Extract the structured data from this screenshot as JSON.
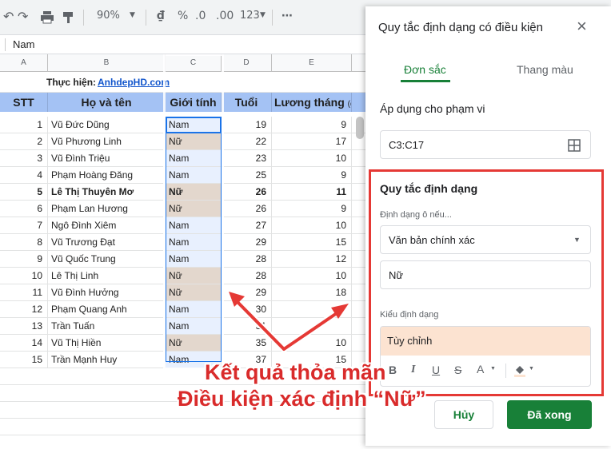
{
  "toolbar": {
    "zoom": "90%",
    "currency": "₫",
    "percent": "%",
    "decrease_decimal": ".0",
    "increase_decimal": ".00",
    "format_more": "123",
    "more": "⋯"
  },
  "formula_bar": {
    "value": "Nam"
  },
  "columns": [
    "A",
    "B",
    "C",
    "D",
    "E"
  ],
  "sheet": {
    "creator_label": "Thực hiện:",
    "creator_link": "AnhdepHD.com",
    "headers": {
      "stt": "STT",
      "name": "Họ và tên",
      "gender": "Giới tính",
      "age": "Tuổi",
      "salary": "Lương tháng"
    },
    "salary_unit": "(đ",
    "rows": [
      {
        "stt": "1",
        "name": "Vũ Đức Dũng",
        "gender": "Nam",
        "age": "19",
        "salary": "9"
      },
      {
        "stt": "2",
        "name": "Vũ Phương Linh",
        "gender": "Nữ",
        "age": "22",
        "salary": "17"
      },
      {
        "stt": "3",
        "name": "Vũ Đình Triệu",
        "gender": "Nam",
        "age": "23",
        "salary": "10"
      },
      {
        "stt": "4",
        "name": "Phạm Hoàng Đăng",
        "gender": "Nam",
        "age": "25",
        "salary": "9"
      },
      {
        "stt": "5",
        "name": "Lê Thị Thuyên Mơ",
        "gender": "Nữ",
        "age": "26",
        "salary": "11"
      },
      {
        "stt": "6",
        "name": "Phạm Lan Hương",
        "gender": "Nữ",
        "age": "26",
        "salary": "9"
      },
      {
        "stt": "7",
        "name": "Ngô Đình Xiêm",
        "gender": "Nam",
        "age": "27",
        "salary": "10"
      },
      {
        "stt": "8",
        "name": "Vũ Trương Đạt",
        "gender": "Nam",
        "age": "29",
        "salary": "15"
      },
      {
        "stt": "9",
        "name": "Vũ Quốc Trung",
        "gender": "Nam",
        "age": "28",
        "salary": "12"
      },
      {
        "stt": "10",
        "name": "Lê Thị Linh",
        "gender": "Nữ",
        "age": "28",
        "salary": "10"
      },
      {
        "stt": "11",
        "name": "Vũ Đình Hưởng",
        "gender": "Nữ",
        "age": "29",
        "salary": "18"
      },
      {
        "stt": "12",
        "name": "Phạm Quang Anh",
        "gender": "Nam",
        "age": "30",
        "salary": ""
      },
      {
        "stt": "13",
        "name": "Trần Tuấn",
        "gender": "Nam",
        "age": "31",
        "salary": ""
      },
      {
        "stt": "14",
        "name": "Vũ Thị Hiền",
        "gender": "Nữ",
        "age": "35",
        "salary": "10"
      },
      {
        "stt": "15",
        "name": "Trần Mạnh Huy",
        "gender": "Nam",
        "age": "37",
        "salary": "15"
      }
    ]
  },
  "panel": {
    "title": "Quy tắc định dạng có điều kiện",
    "tab_single": "Đơn sắc",
    "tab_scale": "Thang màu",
    "range_label": "Áp dụng cho phạm vi",
    "range_value": "C3:C17",
    "rules_title": "Quy tắc định dạng",
    "condition_label": "Định dạng ô nếu...",
    "condition_value": "Văn bản chính xác",
    "value_input": "Nữ",
    "style_label": "Kiểu định dạng",
    "style_preview": "Tùy chỉnh",
    "btn_cancel": "Hủy",
    "btn_done": "Đã xong"
  },
  "annotation": {
    "line1": "Kết quả thỏa mãn",
    "line2": "Điều kiện xác định “Nữ”"
  },
  "colors": {
    "header_blue": "#a4c2f4",
    "female_fill": "#e3d7cd",
    "selection": "#1a73e8",
    "accent_green": "#188038",
    "annotation_red": "#e53935",
    "style_preview_bg": "#fce3d1"
  }
}
